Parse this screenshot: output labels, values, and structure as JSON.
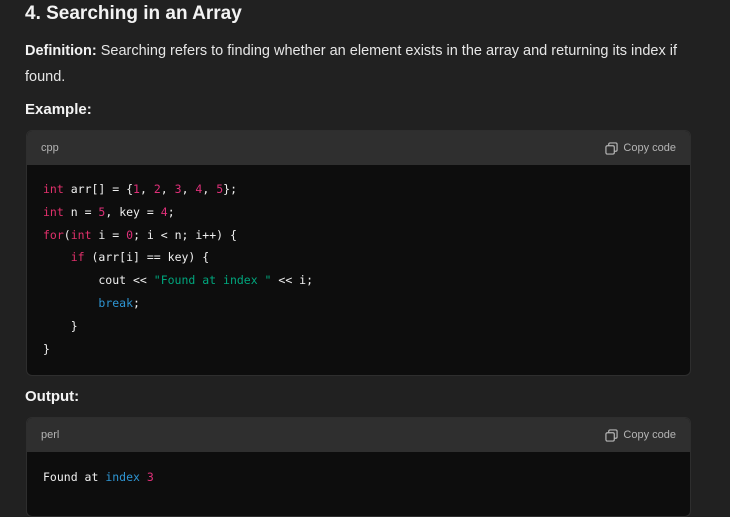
{
  "heading": "4. Searching in an Array",
  "definition": {
    "label": "Definition:",
    "text": " Searching refers to finding whether an element exists in the array and returning its index if found."
  },
  "example_label": "Example:",
  "code_block_1": {
    "language": "cpp",
    "copy_label": "Copy code",
    "lines": [
      [
        [
          "kw",
          "int"
        ],
        [
          "",
          "arr[] = {"
        ],
        [
          "num",
          "1"
        ],
        [
          "",
          ", "
        ],
        [
          "num",
          "2"
        ],
        [
          "",
          ", "
        ],
        [
          "num",
          "3"
        ],
        [
          "",
          ", "
        ],
        [
          "num",
          "4"
        ],
        [
          "",
          ", "
        ],
        [
          "num",
          "5"
        ],
        [
          "",
          "};"
        ]
      ],
      [
        [
          "kw",
          "int"
        ],
        [
          "",
          "n = "
        ],
        [
          "num",
          "5"
        ],
        [
          "",
          ", key = "
        ],
        [
          "num",
          "4"
        ],
        [
          "",
          ";"
        ]
      ],
      [
        [
          "kw",
          "for"
        ],
        [
          "",
          ""
        ],
        [
          "",
          "("
        ],
        [
          "kw",
          "int"
        ],
        [
          "",
          " i = "
        ],
        [
          "num",
          "0"
        ],
        [
          "",
          "; i < n; i++) {"
        ]
      ],
      [
        [
          "",
          "    "
        ],
        [
          "kw",
          "if"
        ],
        [
          "",
          " (arr[i] == key) {"
        ]
      ],
      [
        [
          "",
          "        cout << "
        ],
        [
          "str",
          "\"Found at index \""
        ],
        [
          "",
          " << i;"
        ]
      ],
      [
        [
          "",
          "        "
        ],
        [
          "fn",
          "break"
        ],
        [
          "",
          ";"
        ]
      ],
      [
        [
          "",
          "    }"
        ]
      ],
      [
        [
          "",
          "}"
        ]
      ]
    ]
  },
  "output_label": "Output:",
  "code_block_2": {
    "language": "perl",
    "copy_label": "Copy code",
    "lines": [
      [
        [
          "",
          "Found at "
        ],
        [
          "fn",
          "index"
        ],
        [
          "",
          " "
        ],
        [
          "num",
          "3"
        ]
      ]
    ]
  }
}
